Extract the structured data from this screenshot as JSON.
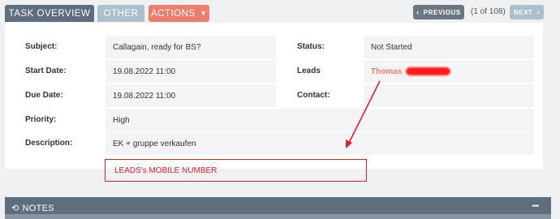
{
  "tabs": {
    "overview": "TASK OVERVIEW",
    "other": "OTHER",
    "actions": "ACTIONS"
  },
  "pager": {
    "previous": "PREVIOUS",
    "count": "(1 of 108)",
    "next": "NEXT"
  },
  "fields": {
    "subject_label": "Subject:",
    "subject_value": "Callagain, ready for BS?",
    "status_label": "Status:",
    "status_value": "Not Started",
    "start_label": "Start Date:",
    "start_value": "19.08.2022 11:00",
    "leads_label": "Leads",
    "leads_value": "Thomas",
    "due_label": "Due Date:",
    "due_value": "19.08.2022 11:00",
    "contact_label": "Contact:",
    "contact_value": "",
    "priority_label": "Priority:",
    "priority_value": "High",
    "description_label": "Description:",
    "description_value": "EK + gruppe verkaufen"
  },
  "annotation": {
    "text": "LEADS's MOBILE NUMBER",
    "color": "#e0202a"
  },
  "notes": {
    "title": "NOTES",
    "toggle": "−"
  },
  "colors": {
    "header_dark": "#5e6e7c",
    "tab_inactive": "#aebfcc",
    "actions": "#ec7e6e",
    "link": "#ec7e6e"
  }
}
